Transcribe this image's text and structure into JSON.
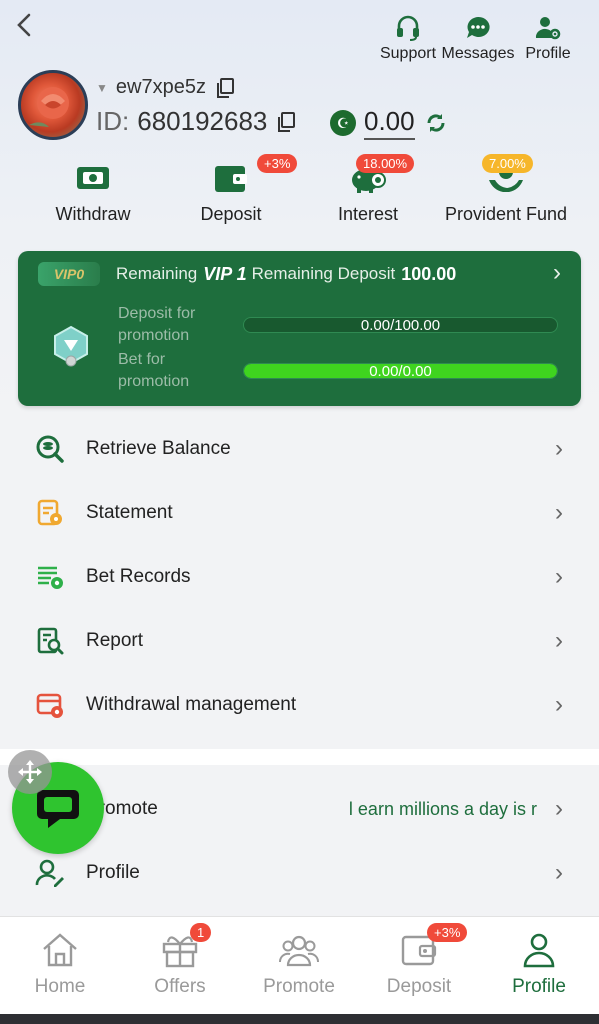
{
  "header": {
    "back_icon": "chevron-left-icon",
    "actions": [
      {
        "label": "Support",
        "icon": "headset-icon"
      },
      {
        "label": "Messages",
        "icon": "chat-dots-icon"
      },
      {
        "label": "Profile",
        "icon": "user-gear-icon"
      }
    ]
  },
  "user": {
    "username": "ew7xpe5z",
    "id_label": "ID:",
    "id_value": "680192683",
    "balance": "0.00",
    "currency_icon": "pakistan-flag-icon"
  },
  "quick_actions": [
    {
      "label": "Withdraw",
      "icon": "cash-icon",
      "badge": ""
    },
    {
      "label": "Deposit",
      "icon": "wallet-icon",
      "badge": "+3%"
    },
    {
      "label": "Interest",
      "icon": "piggy-bank-icon",
      "badge": "18.00%"
    },
    {
      "label": "Provident Fund",
      "icon": "hands-coin-icon",
      "badge": "7.00%"
    }
  ],
  "vip": {
    "tag": "VIP0",
    "remaining_label": "Remaining",
    "next_level": "VIP 1",
    "remaining_deposit_label": "Remaining Deposit",
    "remaining_deposit_value": "100.00",
    "deposit_label": "Deposit for promotion",
    "deposit_progress_text": "0.00/100.00",
    "deposit_progress": 0.0,
    "bet_label": "Bet for promotion",
    "bet_progress_text": "0.00/0.00",
    "bet_progress": 1.0
  },
  "menu": [
    {
      "label": "Retrieve Balance",
      "icon": "coin-search-icon"
    },
    {
      "label": "Statement",
      "icon": "statement-icon"
    },
    {
      "label": "Bet Records",
      "icon": "bet-records-icon"
    },
    {
      "label": "Report",
      "icon": "report-search-icon"
    },
    {
      "label": "Withdrawal management",
      "icon": "withdraw-settings-icon"
    }
  ],
  "menu2": [
    {
      "label": "Promote",
      "icon": "promote-icon",
      "value": "l earn millions a day is r"
    },
    {
      "label": "Profile",
      "icon": "user-edit-icon",
      "value": ""
    }
  ],
  "tabs": [
    {
      "label": "Home",
      "icon": "home-icon",
      "badge": "",
      "active": false
    },
    {
      "label": "Offers",
      "icon": "gift-icon",
      "badge": "1",
      "active": false
    },
    {
      "label": "Promote",
      "icon": "group-icon",
      "badge": "",
      "active": false
    },
    {
      "label": "Deposit",
      "icon": "wallet-icon",
      "badge": "+3%",
      "active": false
    },
    {
      "label": "Profile",
      "icon": "user-icon",
      "badge": "",
      "active": true
    }
  ],
  "colors": {
    "brand_green": "#1e6e3d",
    "progress_green": "#3fd41f",
    "badge_red": "#f04a3a",
    "badge_yellow": "#f6b62a",
    "chat_green": "#2fc42f"
  }
}
